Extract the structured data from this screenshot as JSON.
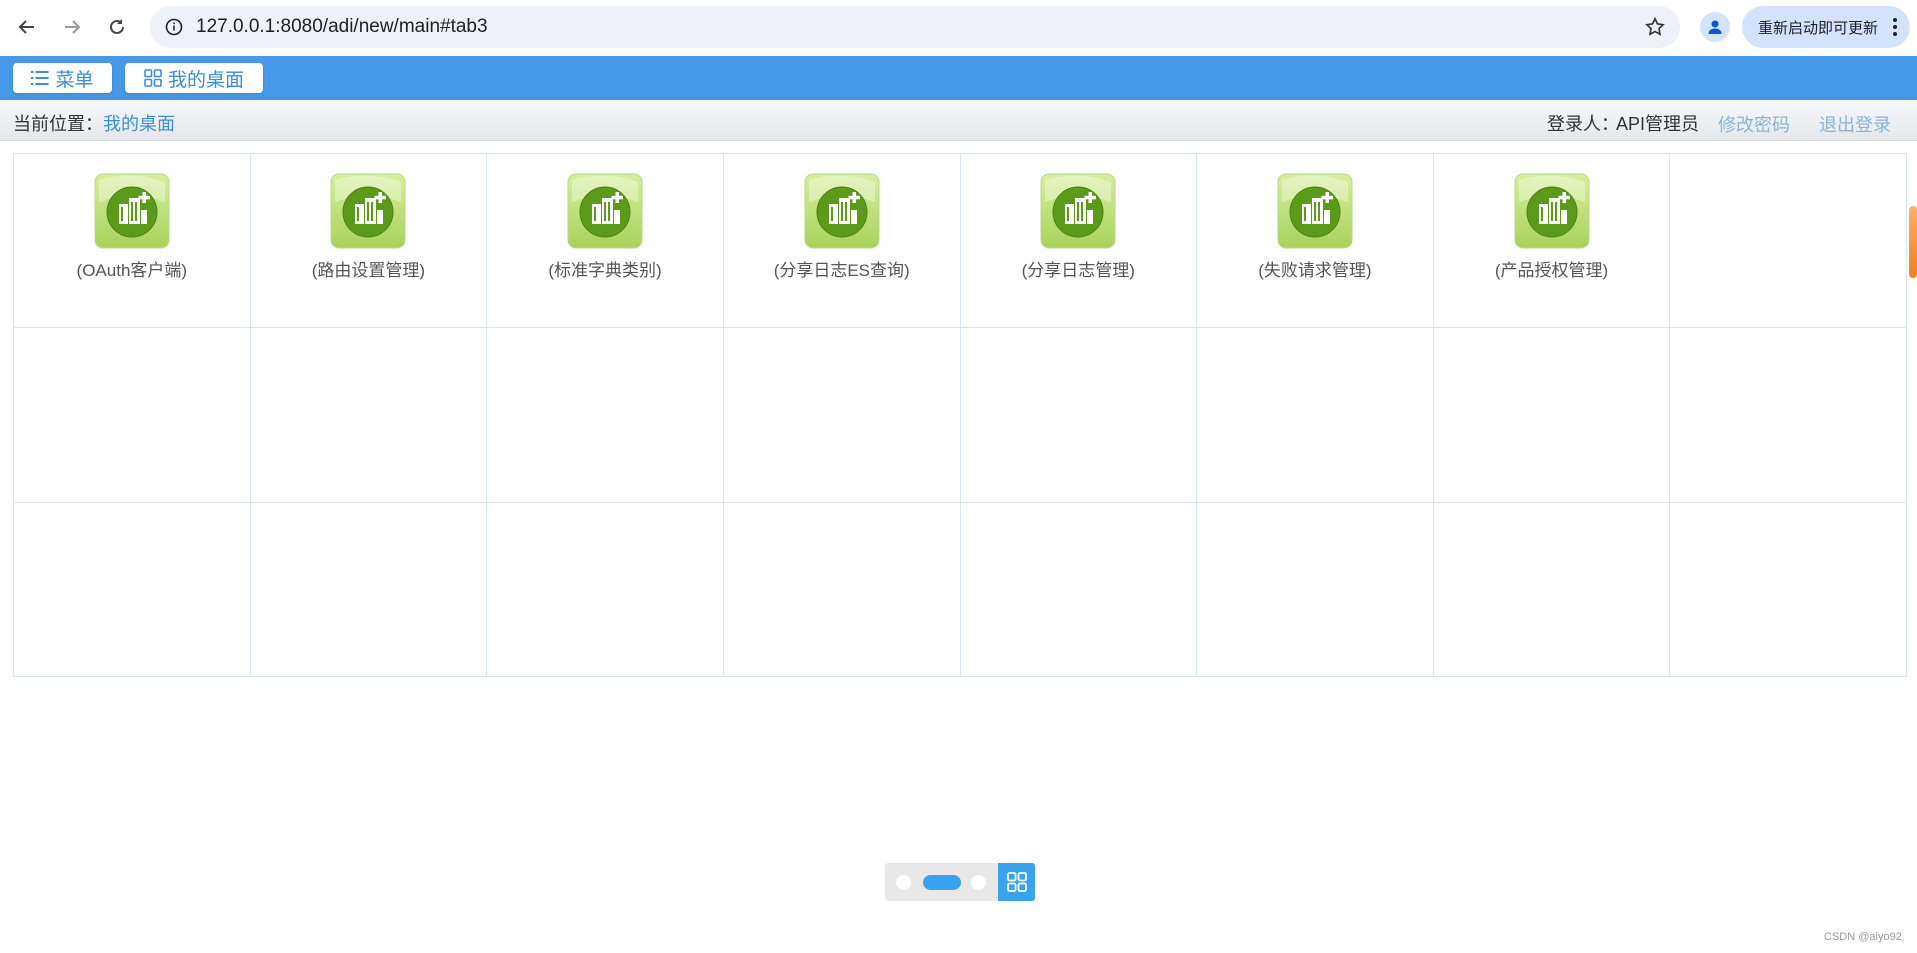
{
  "browser": {
    "url": "127.0.0.1:8080/adi/new/main#tab3",
    "update_label": "重新启动即可更新"
  },
  "header": {
    "menu_label": "菜单",
    "desktop_label": "我的桌面"
  },
  "breadcrumb": {
    "prefix": "当前位置：",
    "current": "我的桌面"
  },
  "user": {
    "login_label": "登录人：",
    "login_name": "API管理员",
    "change_password": "修改密码",
    "logout": "退出登录"
  },
  "desktop": {
    "apps": [
      {
        "label": "(OAuth客户端)"
      },
      {
        "label": "(路由设置管理)"
      },
      {
        "label": "(标准字典类别)"
      },
      {
        "label": "(分享日志ES查询)"
      },
      {
        "label": "(分享日志管理)"
      },
      {
        "label": "(失败请求管理)"
      },
      {
        "label": "(产品授权管理)"
      }
    ],
    "columns": 8,
    "rows": 3,
    "icon": "green-building-add-icon"
  },
  "pager": {
    "pages": 3,
    "active": 2
  },
  "watermark": "CSDN @aiyo92",
  "colors": {
    "header_bg": "#4599e8",
    "accent": "#3b8ed8",
    "pager_active": "#3aa3f0",
    "icon_green": "#5c9a1a"
  }
}
